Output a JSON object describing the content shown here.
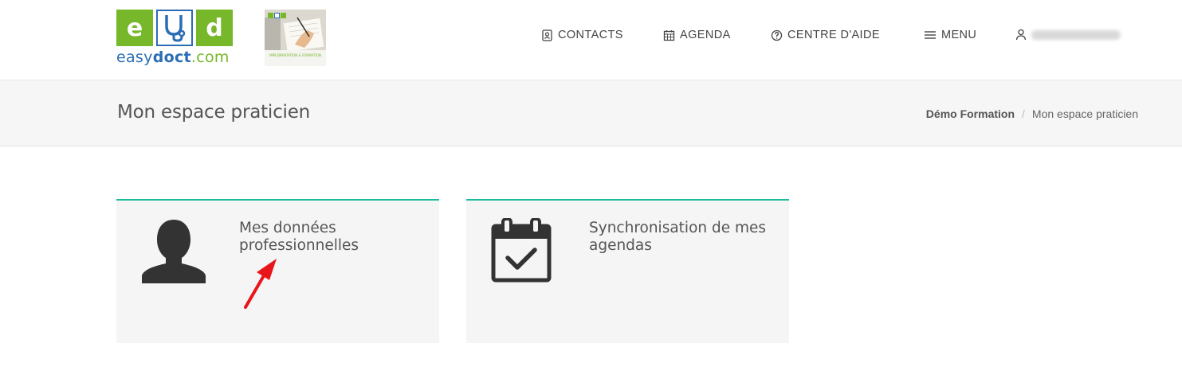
{
  "logo": {
    "tiles": [
      "e",
      "U",
      "d"
    ],
    "text_part1": "easy",
    "text_part2": "doct",
    "text_part3": ".com",
    "icon": "easydoct-logo"
  },
  "thumbnail": {
    "caption": "IMPLEMENTATION & FORMATION",
    "icon": "training-thumbnail-image"
  },
  "nav": {
    "contacts": {
      "label": "CONTACTS",
      "icon": "address-book-icon"
    },
    "agenda": {
      "label": "AGENDA",
      "icon": "calendar-grid-icon"
    },
    "help": {
      "label": "CENTRE D'AIDE",
      "icon": "question-circle-icon"
    },
    "menu": {
      "label": "MENU",
      "icon": "hamburger-icon"
    },
    "user": {
      "icon": "user-icon"
    }
  },
  "titlebar": {
    "title": "Mon espace praticien",
    "breadcrumb": {
      "link": "Démo Formation",
      "separator": "/",
      "current": "Mon espace praticien"
    }
  },
  "cards": [
    {
      "title": "Mes données professionnelles",
      "icon": "user-silhouette-icon"
    },
    {
      "title": "Synchronisation de mes agendas",
      "icon": "calendar-check-icon"
    }
  ],
  "colors": {
    "accent": "#1abc9c",
    "brand_green": "#76b82a",
    "brand_blue": "#2a6db5",
    "annotation_arrow": "#e8161a"
  }
}
